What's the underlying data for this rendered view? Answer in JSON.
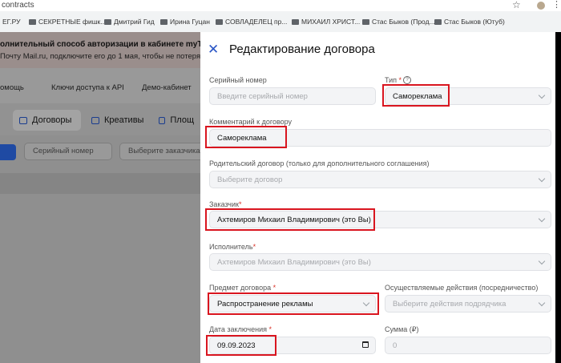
{
  "browser": {
    "url": "contracts",
    "bookmarks": [
      "ЕГ.РУ",
      "СЕКРЕТНЫЕ фишк...",
      "Дмитрий Гид",
      "Ирина Гуцан",
      "СОВЛАДЕЛЕЦ пр...",
      "МИХАИЛ ХРИСТ...",
      "Стас Быков (Прод...",
      "Стас Быков (Ютуб)"
    ]
  },
  "background_page": {
    "banner_title": "олнительный способ авторизации в кабинете myTar",
    "banner_text": "Почту Mail.ru, подключите его до 1 мая, чтобы не потерять д",
    "nav": [
      "омощь",
      "Ключи доступа к API",
      "Демо-кабинет"
    ],
    "tabs": [
      "Договоры",
      "Креативы",
      "Площ"
    ],
    "filters": {
      "serial_placeholder": "Серийный номер",
      "customer_placeholder": "Выберите заказчика"
    }
  },
  "modal": {
    "title": "Редактирование договора",
    "serial": {
      "label": "Серийный номер",
      "placeholder": "Введите серийный номер"
    },
    "type": {
      "label": "Тип",
      "required": "*",
      "value": "Самореклама"
    },
    "comment": {
      "label": "Комментарий к договору",
      "value": "Самореклама"
    },
    "parent": {
      "label": "Родительский договор (только для дополнительного соглашения)",
      "placeholder": "Выберите договор"
    },
    "customer": {
      "label": "Заказчик",
      "required": "*",
      "value": "Ахтемиров Михаил Владимирович (это Вы)"
    },
    "executor": {
      "label": "Исполнитель",
      "required": "*",
      "value": "Ахтемиров Михаил Владимирович (это Вы)"
    },
    "subject": {
      "label": "Предмет договора",
      "required": "*",
      "value": "Распространение рекламы"
    },
    "actions": {
      "label": "Осуществляемые действия (посредничество)",
      "placeholder": "Выберите действия подрядчика"
    },
    "date": {
      "label": "Дата заключения",
      "required": "*",
      "value": "09.09.2023"
    },
    "sum": {
      "label": "Сумма (₽)",
      "value": "0"
    }
  },
  "colors": {
    "highlight": "#d9151f",
    "accent": "#2a56c6"
  }
}
